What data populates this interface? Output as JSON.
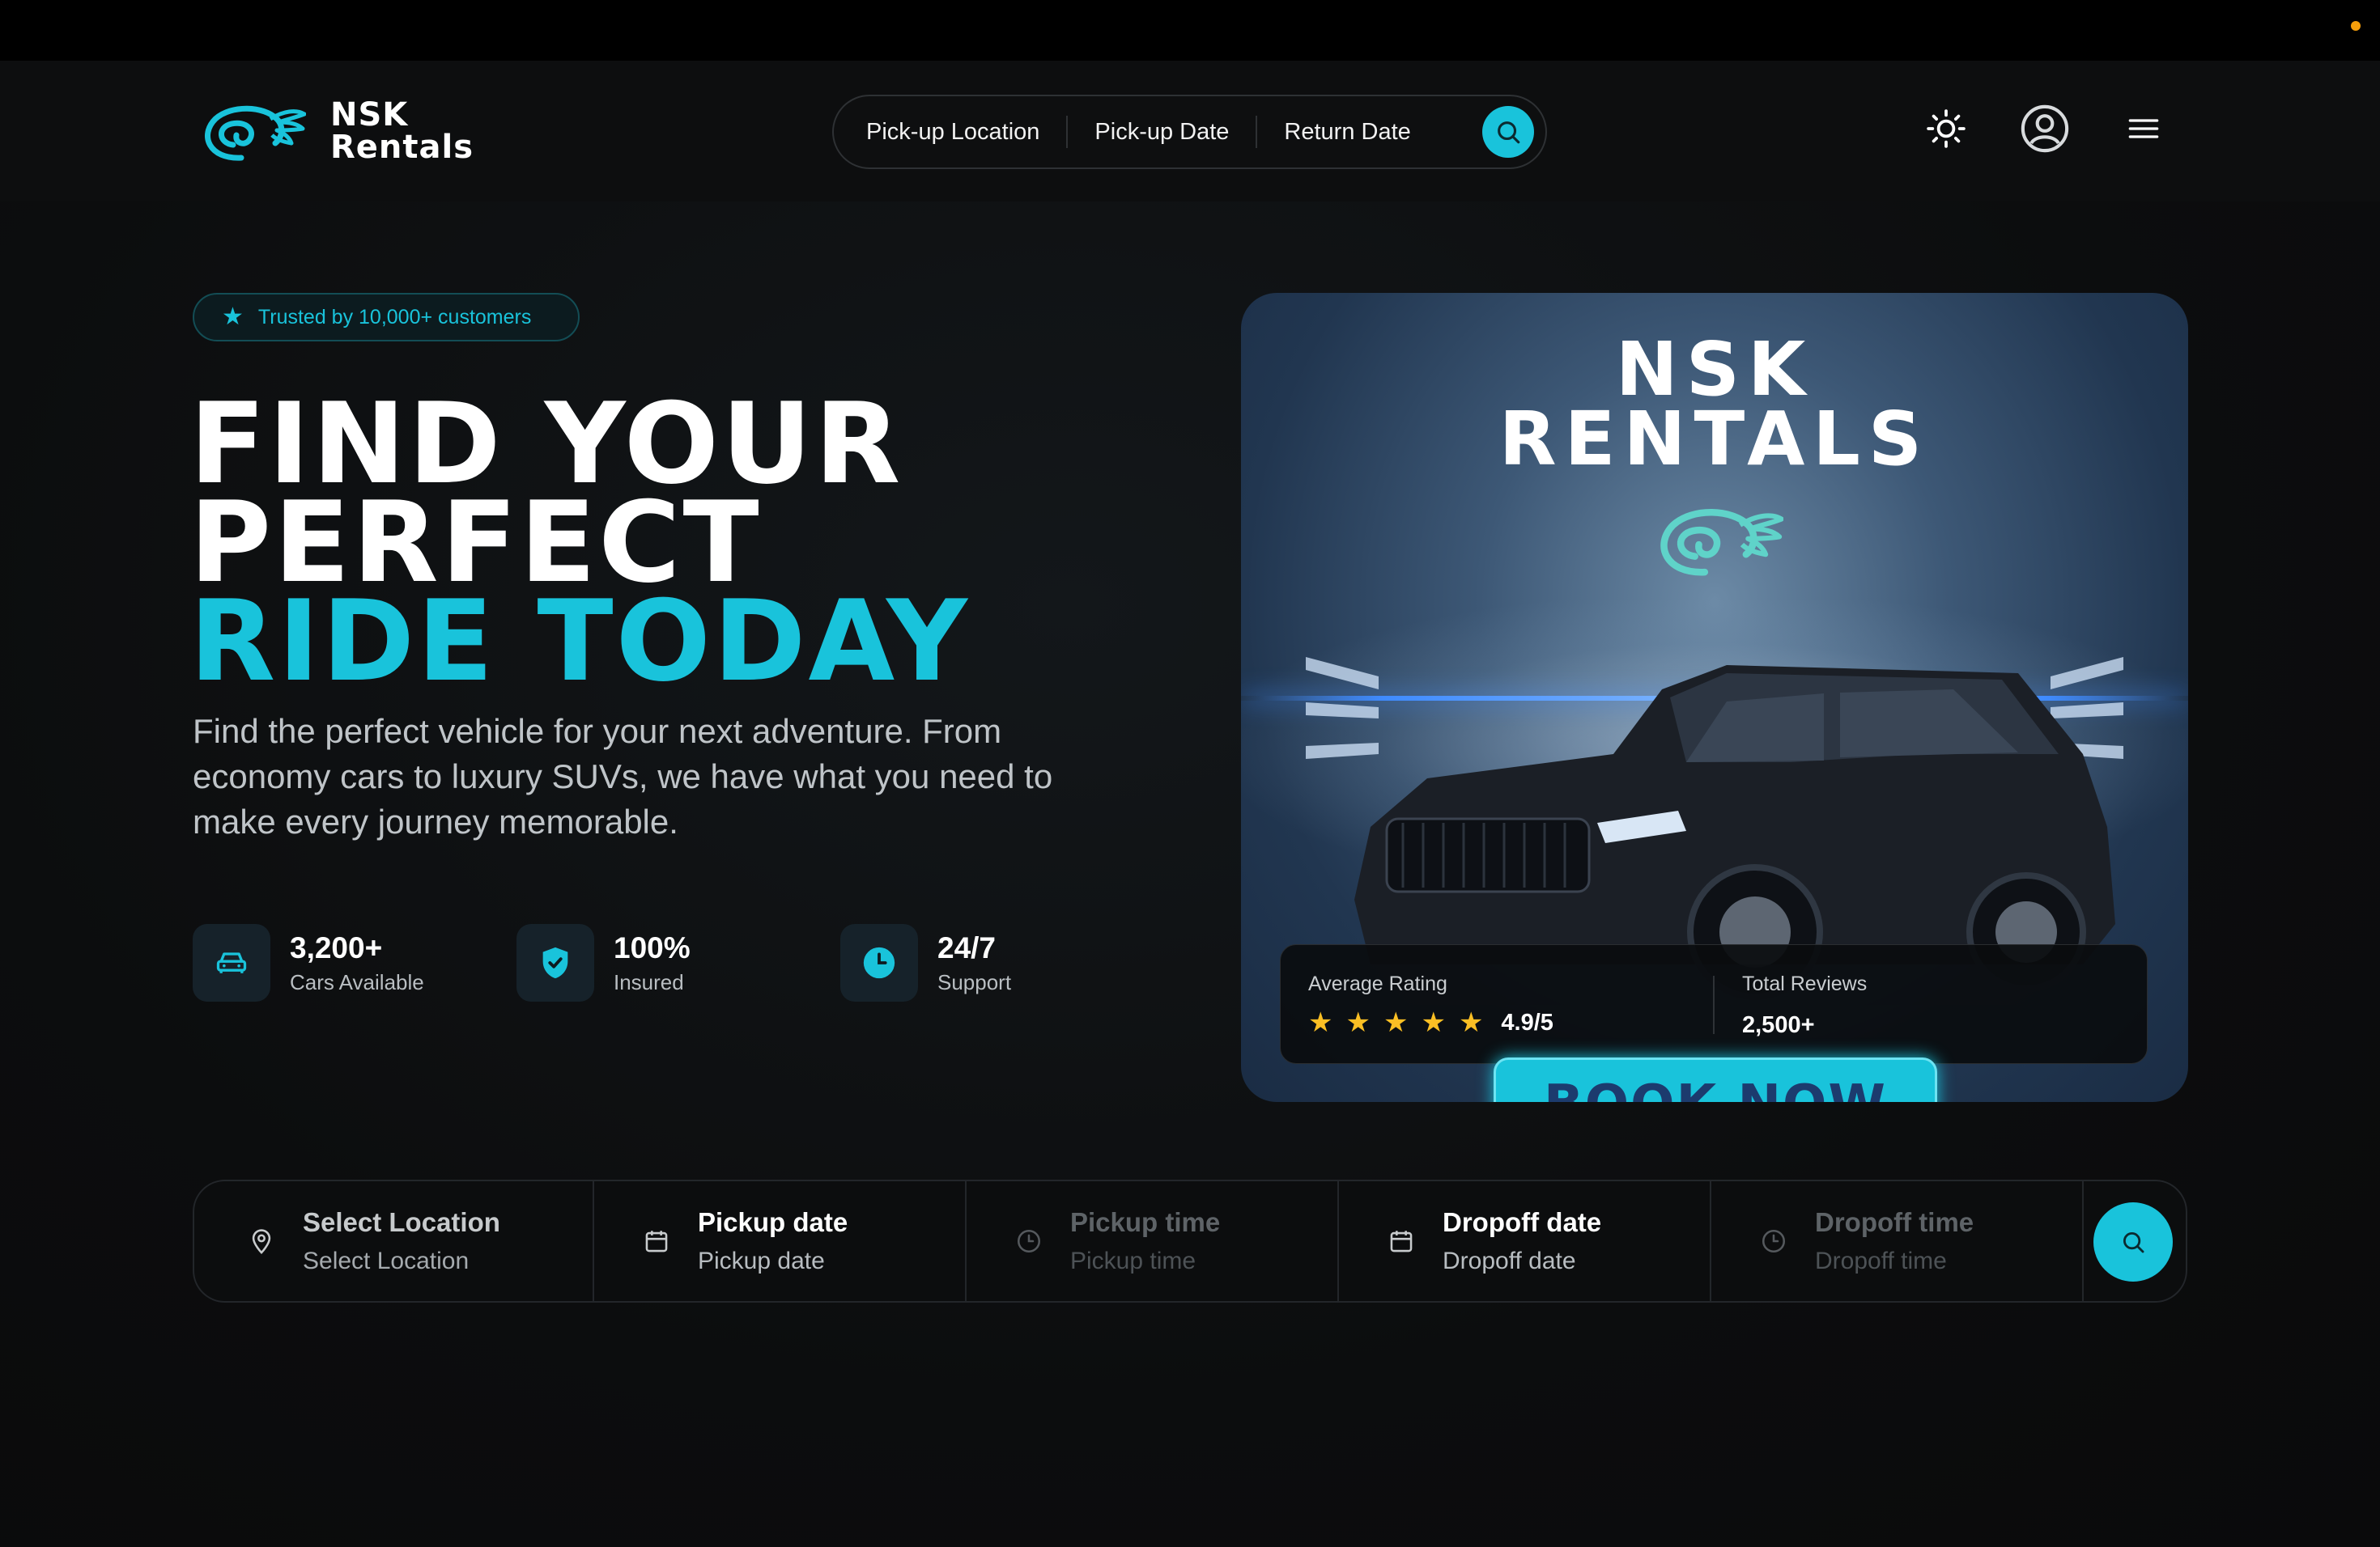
{
  "brand": {
    "name_line1": "NSK",
    "name_line2": "Rentals",
    "accent_color": "#19c3db"
  },
  "header": {
    "search_segments": [
      "Pick-up Location",
      "Pick-up Date",
      "Return Date"
    ],
    "icons": [
      "sun-icon",
      "user-circle-icon",
      "menu-icon"
    ]
  },
  "hero": {
    "badge": "Trusted by 10,000+ customers",
    "headline_line1": "FIND YOUR",
    "headline_line2": "PERFECT",
    "headline_accent": "RIDE TODAY",
    "lead": "Find the perfect vehicle for your next adventure. From economy cars to luxury SUVs, we have what you need to make every journey memorable.",
    "stats": [
      {
        "value": "3,200+",
        "label": "Cars Available",
        "icon": "car-icon"
      },
      {
        "value": "100%",
        "label": "Insured",
        "icon": "shield-check-icon"
      },
      {
        "value": "24/7",
        "label": "Support",
        "icon": "clock-icon"
      }
    ]
  },
  "promo": {
    "title_line1": "NSK",
    "title_line2": "RENTALS",
    "book_label": "BOOK NOW",
    "rating_label": "Average Rating",
    "rating_stars": 5,
    "rating_value": "4.9/5",
    "reviews_label": "Total Reviews",
    "reviews_value": "2,500+"
  },
  "booking": {
    "fields": [
      {
        "title": "Select Location",
        "value": "Select Location",
        "icon": "map-pin-icon"
      },
      {
        "title": "Pickup date",
        "value": "Pickup date",
        "icon": "calendar-icon"
      },
      {
        "title": "Pickup time",
        "value": "Pickup time",
        "icon": "clock-icon"
      },
      {
        "title": "Dropoff date",
        "value": "Dropoff date",
        "icon": "calendar-icon"
      },
      {
        "title": "Dropoff time",
        "value": "Dropoff time",
        "icon": "clock-icon"
      }
    ]
  }
}
